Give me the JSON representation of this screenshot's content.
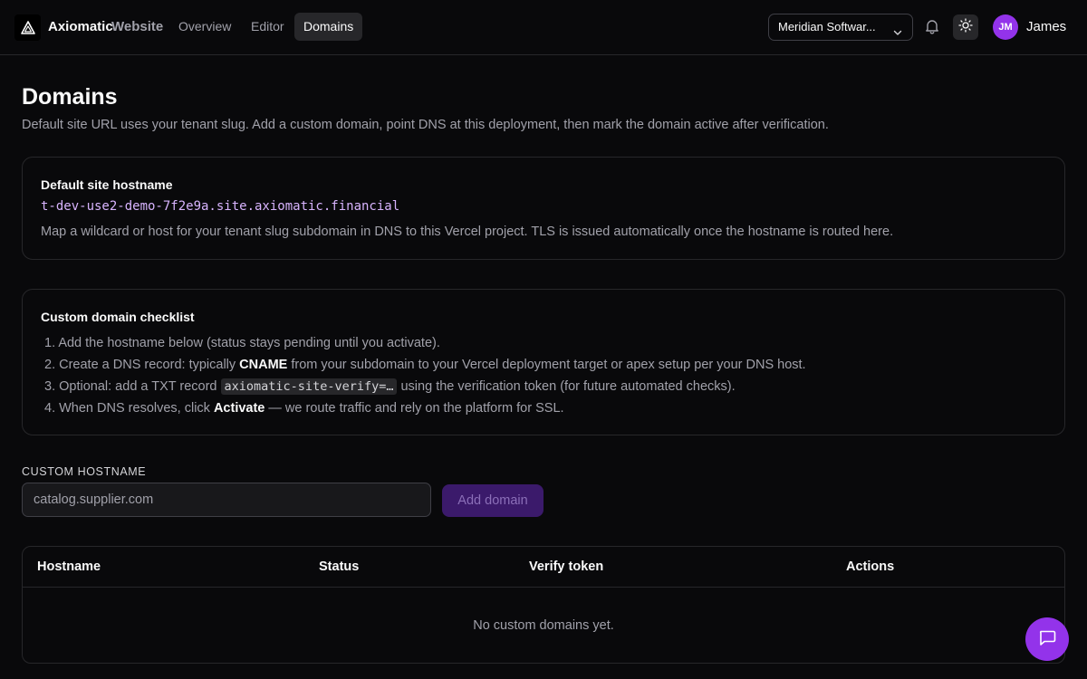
{
  "header": {
    "brand": "Axiomatic",
    "brand_sub": "Website",
    "nav": [
      "Overview",
      "Editor",
      "Domains"
    ],
    "active_nav": "Domains",
    "org_select": "Meridian Softwar...",
    "avatar_initials": "JM",
    "user_name": "James",
    "icons": [
      "axiomatic-logo-icon",
      "chevron-down-icon",
      "bell-icon",
      "sun-icon"
    ]
  },
  "page": {
    "title": "Domains",
    "description": "Default site URL uses your tenant slug. Add a custom domain, point DNS at this deployment, then mark the domain active after verification."
  },
  "default_site": {
    "title": "Default site hostname",
    "hostname": "t-dev-use2-demo-7f2e9a.site.axiomatic.financial",
    "note": "Map a wildcard or host for your tenant slug subdomain in DNS to this Vercel project. TLS is issued automatically once the hostname is routed here."
  },
  "checklist": {
    "title": "Custom domain checklist",
    "step1": "1. Add the hostname below (status stays pending until you activate).",
    "step2_pre": "2. Create a DNS record: typically ",
    "step2_bold": "CNAME",
    "step2_post": " from your subdomain to your Vercel deployment target or apex setup per your DNS host.",
    "step3_pre": "3. Optional: add a TXT record ",
    "step3_code": "axiomatic-site-verify=…",
    "step3_post": " using the verification token (for future automated checks).",
    "step4_pre": "4. When DNS resolves, click ",
    "step4_bold": "Activate",
    "step4_post": " — we route traffic and rely on the platform for SSL."
  },
  "form": {
    "label": "CUSTOM HOSTNAME",
    "placeholder": "catalog.supplier.com",
    "value": "",
    "add_button": "Add domain"
  },
  "table": {
    "columns": [
      "Hostname",
      "Status",
      "Verify token",
      "Actions"
    ],
    "rows": [],
    "empty_text": "No custom domains yet."
  },
  "colors": {
    "background": "#09090b",
    "accent": "#9333ea",
    "code_text": "#d8b4fe",
    "disabled_button": "#3b1a6b"
  },
  "chat": {
    "icon": "chat-bubble-icon"
  }
}
